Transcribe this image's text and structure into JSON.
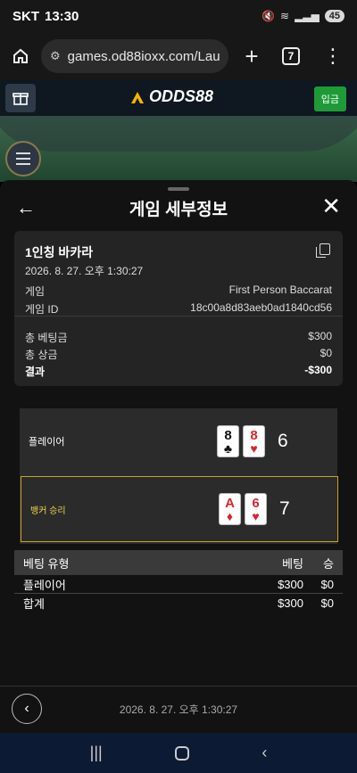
{
  "status": {
    "carrier": "SKT",
    "time": "13:30",
    "battery": "45"
  },
  "browser": {
    "url": "games.od88ioxx.com/Laun",
    "tab_count": "7"
  },
  "site": {
    "logo": "ODDS88",
    "deposit": "입금"
  },
  "panel": {
    "title": "게임 세부정보",
    "game_name": "1인칭 바카라",
    "game_date": "2026. 8. 27. 오후 1:30:27",
    "game_label": "게임",
    "game_value": "First Person Baccarat",
    "id_label": "게임 ID",
    "id_value": "18c00a8d83aeb0ad1840cd56",
    "total_bet_label": "총 베팅금",
    "total_bet_value": "$300",
    "total_win_label": "총 상금",
    "total_win_value": "$0",
    "result_label": "결과",
    "result_value": "-$300"
  },
  "hands": {
    "player": {
      "label": "플레이어",
      "score": "6",
      "cards": [
        {
          "rank": "8",
          "suit": "♣",
          "color": "black"
        },
        {
          "rank": "8",
          "suit": "♥",
          "color": "red"
        }
      ]
    },
    "banker": {
      "label": "뱅커 승리",
      "score": "7",
      "cards": [
        {
          "rank": "A",
          "suit": "♦",
          "color": "red"
        },
        {
          "rank": "6",
          "suit": "♥",
          "color": "red"
        }
      ]
    }
  },
  "bet_table": {
    "headers": [
      "베팅 유형",
      "베팅",
      "승"
    ],
    "rows": [
      [
        "플레이어",
        "$300",
        "$0"
      ]
    ],
    "total": [
      "합계",
      "$300",
      "$0"
    ]
  },
  "footer": {
    "date": "2026. 8. 27. 오후 1:30:27"
  },
  "colors": {
    "accent_gold": "#c9a227",
    "deposit_green": "#1e9a37"
  }
}
